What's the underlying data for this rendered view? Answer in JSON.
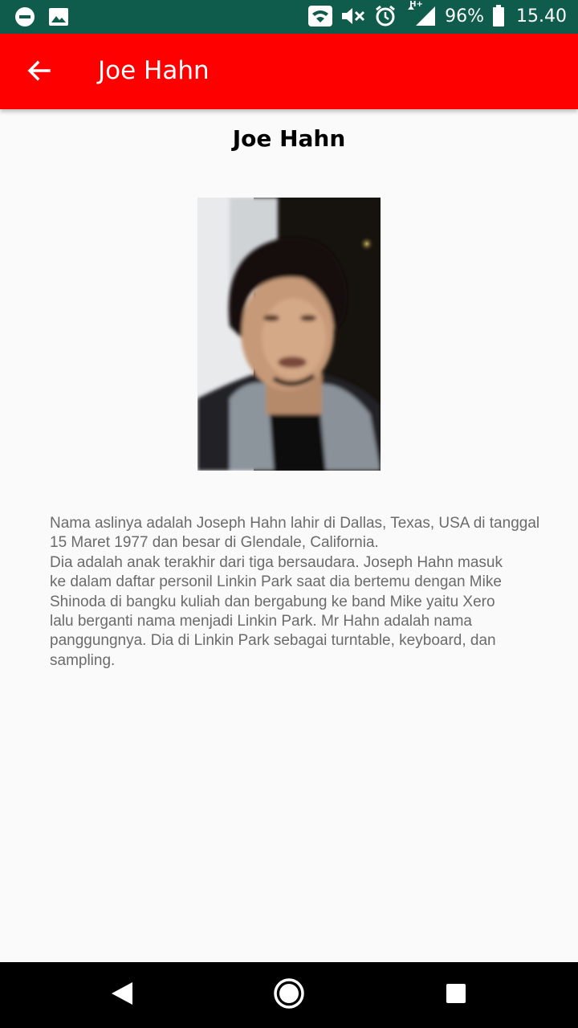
{
  "status_bar": {
    "battery": "96%",
    "time": "15.40",
    "network": "H+",
    "icons": [
      "dnd-icon",
      "image-icon",
      "wifi-icon",
      "mute-icon",
      "alarm-icon",
      "signal-icon",
      "battery-icon"
    ]
  },
  "app_bar": {
    "title": "Joe Hahn",
    "back_icon": "arrow-back-icon",
    "background": "#ff0000"
  },
  "content": {
    "title": "Joe Hahn",
    "bio": " Nama aslinya adalah Joseph Hahn lahir di Dallas, Texas, USA di tanggal\n15 Maret 1977 dan besar di Glendale, California.\nDia adalah anak terakhir dari tiga bersaudara. Joseph Hahn masuk\nke dalam daftar personil Linkin Park saat dia bertemu dengan Mike\nShinoda di bangku kuliah dan bergabung ke band Mike yaitu Xero\nlalu berganti nama menjadi Linkin Park. Mr Hahn adalah nama\npanggungnya. Dia di Linkin Park sebagai turntable, keyboard, dan\nsampling."
  },
  "nav_bar": {
    "icons": [
      "back-triangle-icon",
      "home-circle-icon",
      "recents-square-icon"
    ]
  }
}
